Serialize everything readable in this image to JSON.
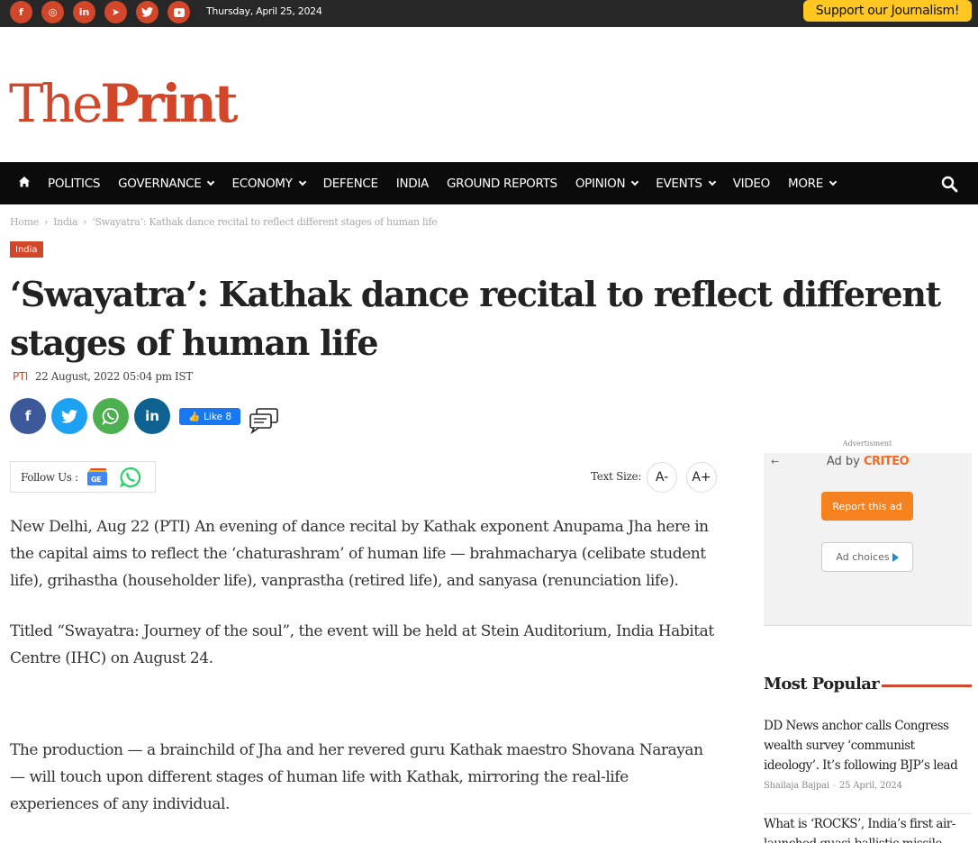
{
  "topbar": {
    "social": [
      {
        "icon": "facebook-icon",
        "glyph": "f"
      },
      {
        "icon": "instagram-icon",
        "glyph": "◎"
      },
      {
        "icon": "linkedin-icon",
        "glyph": "in"
      },
      {
        "icon": "telegram-icon",
        "glyph": "➤"
      },
      {
        "icon": "twitter-icon",
        "glyph": "🐦"
      },
      {
        "icon": "youtube-icon",
        "glyph": "▶"
      }
    ],
    "date": "Thursday, April 25, 2024",
    "support": "Support our Journalism!"
  },
  "logo": {
    "part1": "The",
    "part2": "Print"
  },
  "nav": {
    "items": [
      {
        "label": "POLITICS",
        "dropdown": false
      },
      {
        "label": "GOVERNANCE",
        "dropdown": true
      },
      {
        "label": "ECONOMY",
        "dropdown": true
      },
      {
        "label": "DEFENCE",
        "dropdown": false
      },
      {
        "label": "INDIA",
        "dropdown": false
      },
      {
        "label": "GROUND REPORTS",
        "dropdown": false
      },
      {
        "label": "OPINION",
        "dropdown": true
      },
      {
        "label": "EVENTS",
        "dropdown": true
      },
      {
        "label": "VIDEO",
        "dropdown": false
      },
      {
        "label": "MORE",
        "dropdown": true
      }
    ]
  },
  "breadcrumb": {
    "home": "Home",
    "sep": "›",
    "section": "India",
    "current": "‘Swayatra’: Kathak dance recital to reflect different stages of human life"
  },
  "article": {
    "category": "India",
    "title": "‘Swayatra’: Kathak dance recital to reflect different stages of human life",
    "author": "PTI",
    "date": "22 August, 2022 05:04 pm IST",
    "like_label": "Like 8",
    "follow_label": "Follow Us :",
    "text_size_label": "Text Size:",
    "text_minus": "A-",
    "text_plus": "A+",
    "paragraphs": [
      "New Delhi, Aug 22 (PTI) An evening of dance recital by Kathak exponent Anupama Jha here in the capital aims to reflect the ‘chaturashram’ of human life — brahmacharya (celibate student life), grihastha (householder life), vanprastha (retired life), and sanyasa (renunciation life).",
      "Titled “Swayatra: Journey of the soul”, the event will be held at Stein Auditorium, India Habitat Centre (IHC) on August 24.",
      "The production — a brainchild of Jha and her revered guru Kathak maestro Shovana Narayan — will touch upon different stages of human life with Kathak, mirroring the real-life experiences of any individual."
    ]
  },
  "sidebar": {
    "ad_label": "Advertisment",
    "ad_by": "Ad by",
    "ad_brand": "CRITEO",
    "ad_report": "Report this ad",
    "ad_choices": "Ad choices",
    "most_popular": "Most Popular",
    "items": [
      {
        "headline": "DD News anchor calls Congress wealth survey ‘communist ideology’. It’s following BJP’s lead",
        "author": "Shailaja Bajpai",
        "date": "25 April, 2024"
      },
      {
        "headline": "What is ‘ROCKS’, India’s first air-launched quasi-ballistic missile",
        "author": "",
        "date": ""
      }
    ]
  },
  "colors": {
    "brand": "#d2472a",
    "nav_bg": "#0b0b0b",
    "topbar_bg": "#272727",
    "support_bg": "#ffc721",
    "facebook": "#3b5998",
    "twitter": "#1da1f2",
    "whatsapp": "#4caf50",
    "linkedin": "#0e6291"
  }
}
